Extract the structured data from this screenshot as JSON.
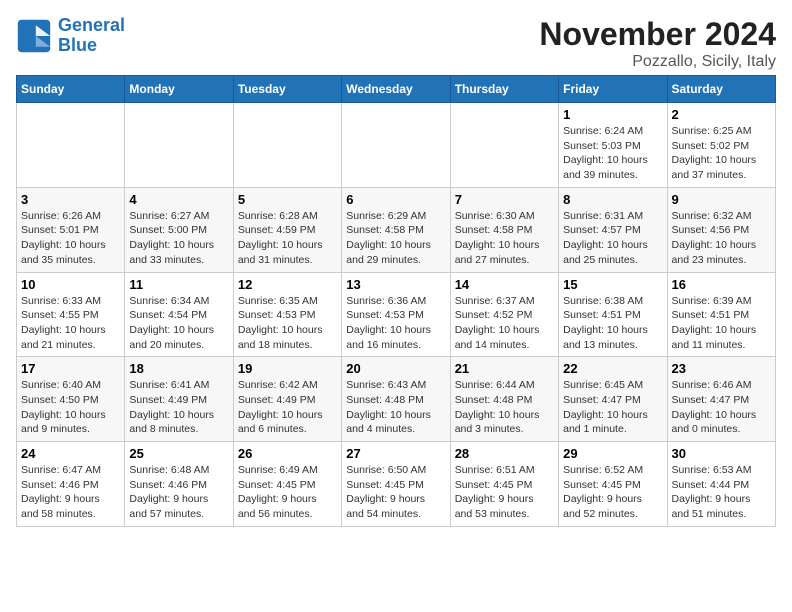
{
  "header": {
    "logo_line1": "General",
    "logo_line2": "Blue",
    "month": "November 2024",
    "location": "Pozzallo, Sicily, Italy"
  },
  "weekdays": [
    "Sunday",
    "Monday",
    "Tuesday",
    "Wednesday",
    "Thursday",
    "Friday",
    "Saturday"
  ],
  "weeks": [
    [
      {
        "day": "",
        "info": ""
      },
      {
        "day": "",
        "info": ""
      },
      {
        "day": "",
        "info": ""
      },
      {
        "day": "",
        "info": ""
      },
      {
        "day": "",
        "info": ""
      },
      {
        "day": "1",
        "info": "Sunrise: 6:24 AM\nSunset: 5:03 PM\nDaylight: 10 hours\nand 39 minutes."
      },
      {
        "day": "2",
        "info": "Sunrise: 6:25 AM\nSunset: 5:02 PM\nDaylight: 10 hours\nand 37 minutes."
      }
    ],
    [
      {
        "day": "3",
        "info": "Sunrise: 6:26 AM\nSunset: 5:01 PM\nDaylight: 10 hours\nand 35 minutes."
      },
      {
        "day": "4",
        "info": "Sunrise: 6:27 AM\nSunset: 5:00 PM\nDaylight: 10 hours\nand 33 minutes."
      },
      {
        "day": "5",
        "info": "Sunrise: 6:28 AM\nSunset: 4:59 PM\nDaylight: 10 hours\nand 31 minutes."
      },
      {
        "day": "6",
        "info": "Sunrise: 6:29 AM\nSunset: 4:58 PM\nDaylight: 10 hours\nand 29 minutes."
      },
      {
        "day": "7",
        "info": "Sunrise: 6:30 AM\nSunset: 4:58 PM\nDaylight: 10 hours\nand 27 minutes."
      },
      {
        "day": "8",
        "info": "Sunrise: 6:31 AM\nSunset: 4:57 PM\nDaylight: 10 hours\nand 25 minutes."
      },
      {
        "day": "9",
        "info": "Sunrise: 6:32 AM\nSunset: 4:56 PM\nDaylight: 10 hours\nand 23 minutes."
      }
    ],
    [
      {
        "day": "10",
        "info": "Sunrise: 6:33 AM\nSunset: 4:55 PM\nDaylight: 10 hours\nand 21 minutes."
      },
      {
        "day": "11",
        "info": "Sunrise: 6:34 AM\nSunset: 4:54 PM\nDaylight: 10 hours\nand 20 minutes."
      },
      {
        "day": "12",
        "info": "Sunrise: 6:35 AM\nSunset: 4:53 PM\nDaylight: 10 hours\nand 18 minutes."
      },
      {
        "day": "13",
        "info": "Sunrise: 6:36 AM\nSunset: 4:53 PM\nDaylight: 10 hours\nand 16 minutes."
      },
      {
        "day": "14",
        "info": "Sunrise: 6:37 AM\nSunset: 4:52 PM\nDaylight: 10 hours\nand 14 minutes."
      },
      {
        "day": "15",
        "info": "Sunrise: 6:38 AM\nSunset: 4:51 PM\nDaylight: 10 hours\nand 13 minutes."
      },
      {
        "day": "16",
        "info": "Sunrise: 6:39 AM\nSunset: 4:51 PM\nDaylight: 10 hours\nand 11 minutes."
      }
    ],
    [
      {
        "day": "17",
        "info": "Sunrise: 6:40 AM\nSunset: 4:50 PM\nDaylight: 10 hours\nand 9 minutes."
      },
      {
        "day": "18",
        "info": "Sunrise: 6:41 AM\nSunset: 4:49 PM\nDaylight: 10 hours\nand 8 minutes."
      },
      {
        "day": "19",
        "info": "Sunrise: 6:42 AM\nSunset: 4:49 PM\nDaylight: 10 hours\nand 6 minutes."
      },
      {
        "day": "20",
        "info": "Sunrise: 6:43 AM\nSunset: 4:48 PM\nDaylight: 10 hours\nand 4 minutes."
      },
      {
        "day": "21",
        "info": "Sunrise: 6:44 AM\nSunset: 4:48 PM\nDaylight: 10 hours\nand 3 minutes."
      },
      {
        "day": "22",
        "info": "Sunrise: 6:45 AM\nSunset: 4:47 PM\nDaylight: 10 hours\nand 1 minute."
      },
      {
        "day": "23",
        "info": "Sunrise: 6:46 AM\nSunset: 4:47 PM\nDaylight: 10 hours\nand 0 minutes."
      }
    ],
    [
      {
        "day": "24",
        "info": "Sunrise: 6:47 AM\nSunset: 4:46 PM\nDaylight: 9 hours\nand 58 minutes."
      },
      {
        "day": "25",
        "info": "Sunrise: 6:48 AM\nSunset: 4:46 PM\nDaylight: 9 hours\nand 57 minutes."
      },
      {
        "day": "26",
        "info": "Sunrise: 6:49 AM\nSunset: 4:45 PM\nDaylight: 9 hours\nand 56 minutes."
      },
      {
        "day": "27",
        "info": "Sunrise: 6:50 AM\nSunset: 4:45 PM\nDaylight: 9 hours\nand 54 minutes."
      },
      {
        "day": "28",
        "info": "Sunrise: 6:51 AM\nSunset: 4:45 PM\nDaylight: 9 hours\nand 53 minutes."
      },
      {
        "day": "29",
        "info": "Sunrise: 6:52 AM\nSunset: 4:45 PM\nDaylight: 9 hours\nand 52 minutes."
      },
      {
        "day": "30",
        "info": "Sunrise: 6:53 AM\nSunset: 4:44 PM\nDaylight: 9 hours\nand 51 minutes."
      }
    ]
  ]
}
